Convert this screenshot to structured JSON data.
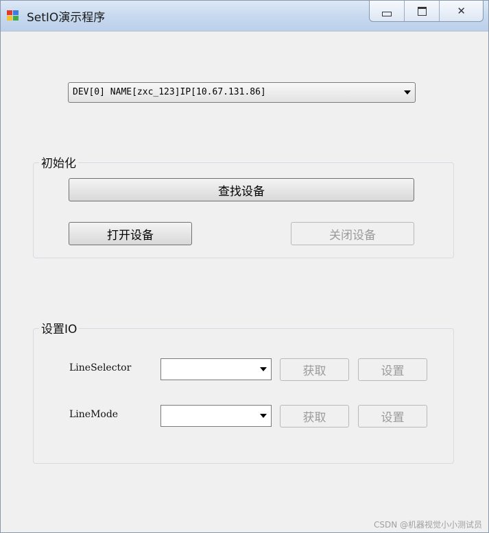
{
  "window": {
    "title": "SetIO演示程序",
    "controls": {
      "minimize": "▭",
      "maximize": "□",
      "close": "✕"
    }
  },
  "device": {
    "selected": "DEV[0] NAME[zxc_123]IP[10.67.131.86]"
  },
  "init_group": {
    "label": "初始化",
    "find_button": "查找设备",
    "open_button": "打开设备",
    "close_button": "关闭设备"
  },
  "io_group": {
    "label": "设置IO",
    "rows": [
      {
        "label": "LineSelector",
        "value": "",
        "get_button": "获取",
        "set_button": "设置"
      },
      {
        "label": "LineMode",
        "value": "",
        "get_button": "获取",
        "set_button": "设置"
      }
    ]
  },
  "watermark": "CSDN @机器视觉小小测试员",
  "colors": {
    "titlebar": "#c6d8ee",
    "client": "#f0f0f0",
    "disabled_text": "#9a9a9a"
  }
}
